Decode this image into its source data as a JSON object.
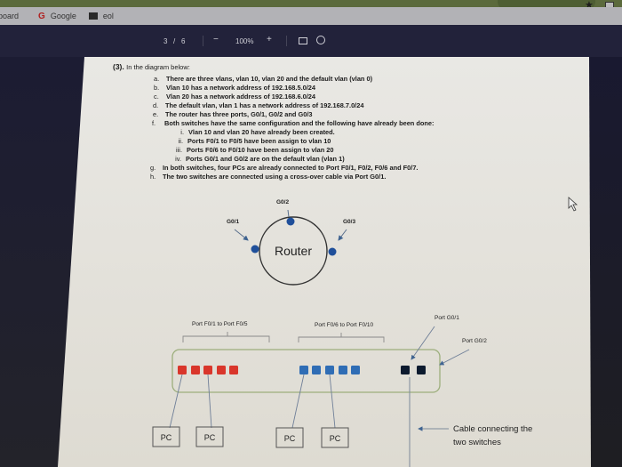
{
  "browser": {
    "bookmarks": [
      {
        "label": "board",
        "icon": "none"
      },
      {
        "label": "Google",
        "icon": "google-icon"
      },
      {
        "label": "eol",
        "icon": "app-icon"
      }
    ],
    "star_icon": "star-icon",
    "extension_icon": "extension-icon"
  },
  "pdf_toolbar": {
    "page_current": "3",
    "page_separator": "/",
    "page_total": "6",
    "zoom_out": "−",
    "zoom_level": "100%",
    "zoom_in": "+",
    "fit_icon": "fit-page-icon",
    "rotate_icon": "rotate-icon"
  },
  "document": {
    "question_number": "(3).",
    "question_intro": "In the diagram below:",
    "items": [
      {
        "marker": "a.",
        "text": "There are three vlans, vlan 10, vlan 20 and the default vlan (vlan 0)"
      },
      {
        "marker": "b.",
        "text": "Vlan 10 has a network address of 192.168.5.0/24"
      },
      {
        "marker": "c.",
        "text": "Vlan 20 has a network address of 192.168.6.0/24"
      },
      {
        "marker": "d.",
        "text": "The default vlan, vlan 1 has a network address of 192.168.7.0/24"
      },
      {
        "marker": "e.",
        "text": "The router has three ports, G0/1, G0/2 and G0/3"
      },
      {
        "marker": "f.",
        "text": "Both switches have the same configuration and the following have already been done:"
      }
    ],
    "subitems": [
      {
        "marker": "i.",
        "text": "Vlan 10 and vlan 20 have already been created."
      },
      {
        "marker": "ii.",
        "text": "Ports F0/1 to F0/5 have been assign to vlan 10"
      },
      {
        "marker": "iii.",
        "text": "Ports F0/6 to F0/10 have been assign to vlan 20"
      },
      {
        "marker": "iv.",
        "text": "Ports G0/1 and G0/2 are on the default vlan (vlan 1)"
      }
    ],
    "items_after": [
      {
        "marker": "g.",
        "text": "In both switches, four PCs are already connected to Port F0/1, F0/2, F0/6 and F0/7."
      },
      {
        "marker": "h.",
        "text": "The two switches are connected using a cross-over cable via Port G0/1."
      }
    ]
  },
  "diagram": {
    "router_label": "Router",
    "router_ports": [
      "G0/1",
      "G0/2",
      "G0/3"
    ],
    "group1_label": "Port F0/1 to Port F0/5",
    "group2_label": "Port F0/6 to Port F0/10",
    "uplink1_label": "Port G0/1",
    "uplink2_label": "Port G0/2",
    "cable_label_line1": "Cable connecting the",
    "cable_label_line2": "two switches",
    "pc_label": "PC",
    "colors": {
      "vlan10_port": "#d9362b",
      "vlan20_port": "#2f6db5",
      "uplink_port": "#0c1a2e",
      "router_port": "#1f4f9a",
      "switch_border": "#9cae7c"
    }
  }
}
